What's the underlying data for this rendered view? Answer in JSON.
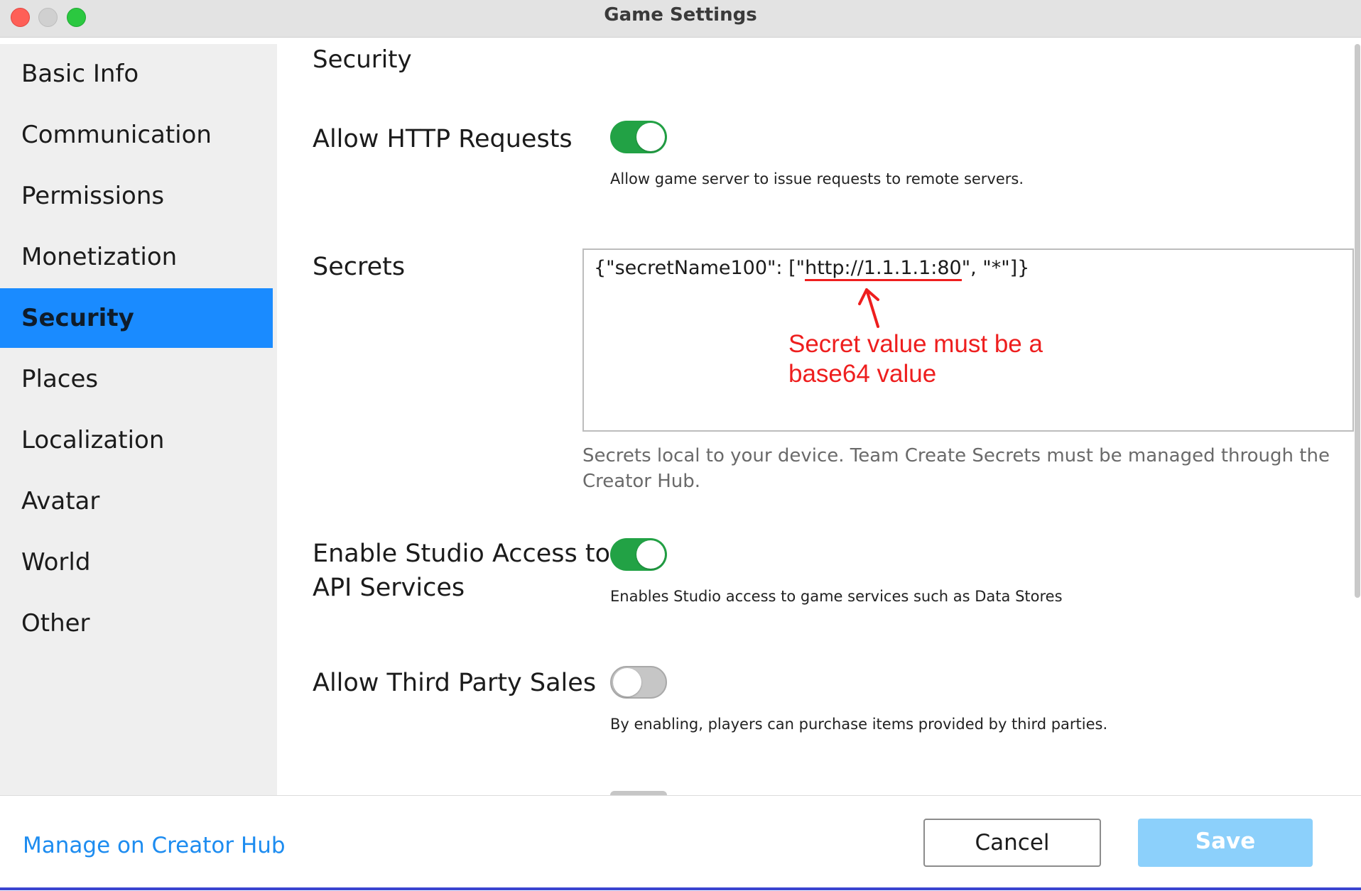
{
  "window": {
    "title": "Game Settings",
    "traffic_lights": [
      "close",
      "minimize",
      "maximize"
    ]
  },
  "sidebar": {
    "items": [
      {
        "label": "Basic Info"
      },
      {
        "label": "Communication"
      },
      {
        "label": "Permissions"
      },
      {
        "label": "Monetization"
      },
      {
        "label": "Security"
      },
      {
        "label": "Places"
      },
      {
        "label": "Localization"
      },
      {
        "label": "Avatar"
      },
      {
        "label": "World"
      },
      {
        "label": "Other"
      }
    ],
    "active": "Security"
  },
  "main": {
    "section_title": "Security",
    "allow_http": {
      "label": "Allow HTTP Requests",
      "enabled": true,
      "description": "Allow game server to issue requests to remote servers."
    },
    "secrets": {
      "label": "Secrets",
      "value_prefix": "{\"secretName100\": [\"",
      "value_url": "http://1.1.1.1:80",
      "value_suffix": "\", \"*\"]}",
      "annotation_line1": "Secret value must be a",
      "annotation_line2": "base64 value",
      "description": "Secrets local to your device. Team Create Secrets must be managed through the Creator Hub."
    },
    "studio_api": {
      "label_line1": "Enable Studio Access to",
      "label_line2": "API Services",
      "enabled": true,
      "description": "Enables Studio access to game services such as Data Stores"
    },
    "third_party_sales": {
      "label": "Allow Third Party Sales",
      "enabled": false,
      "description": "By enabling, players can purchase items provided by third parties."
    }
  },
  "footer": {
    "link": "Manage on Creator Hub",
    "cancel_label": "Cancel",
    "save_label": "Save"
  },
  "colors": {
    "accent": "#1a8bff",
    "toggle_on": "#22a245",
    "annotation": "#ee1e1e",
    "save_disabled": "#8cd0fb"
  }
}
